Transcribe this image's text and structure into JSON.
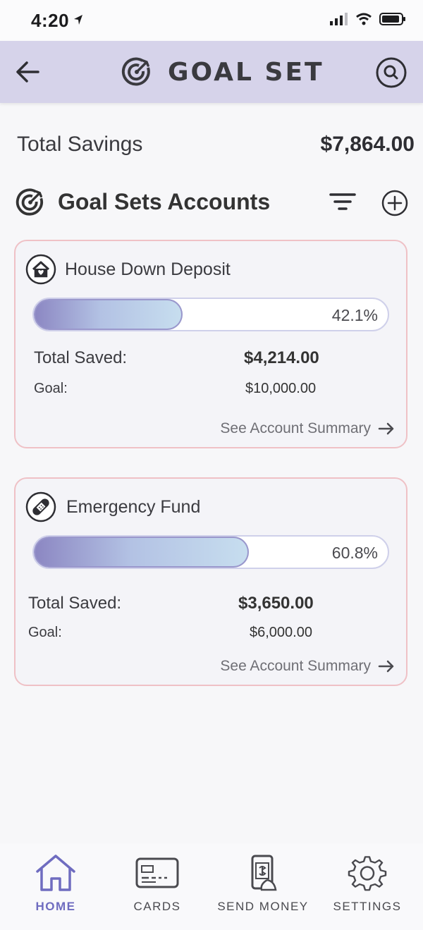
{
  "status_bar": {
    "time": "4:20"
  },
  "header": {
    "title": "GOAL SET"
  },
  "summary": {
    "label": "Total Savings",
    "value": "$7,864.00"
  },
  "section": {
    "title": "Goal Sets Accounts"
  },
  "accounts": [
    {
      "name": "House Down Deposit",
      "icon": "house-icon",
      "progress": 0.421,
      "progress_label": "42.1%",
      "saved_label": "Total Saved:",
      "saved_value": "$4,214.00",
      "goal_label": "Goal:",
      "goal_value": "$10,000.00",
      "link_label": "See Account Summary"
    },
    {
      "name": "Emergency Fund",
      "icon": "bandage-icon",
      "progress": 0.608,
      "progress_label": "60.8%",
      "saved_label": "Total Saved:",
      "saved_value": "$3,650.00",
      "goal_label": "Goal:",
      "goal_value": "$6,000.00",
      "link_label": "See Account Summary"
    }
  ],
  "tabs": [
    {
      "label": "HOME",
      "icon": "home-icon",
      "active": true
    },
    {
      "label": "CARDS",
      "icon": "card-icon",
      "active": false
    },
    {
      "label": "SEND MONEY",
      "icon": "send-money-icon",
      "active": false
    },
    {
      "label": "SETTINGS",
      "icon": "gear-icon",
      "active": false
    }
  ],
  "colors": {
    "header_bg": "#d6d3ea",
    "card_border": "#efc1c6",
    "active_tab": "#6f6cc0",
    "progress_start": "#8b86c2",
    "progress_end": "#c7deef"
  }
}
